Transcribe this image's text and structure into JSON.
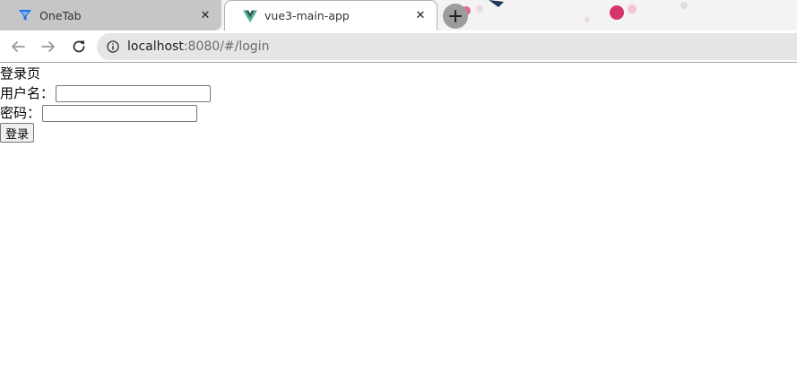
{
  "browser": {
    "tabs": [
      {
        "title": "OneTab",
        "active": false,
        "icon": "onetab-funnel-icon"
      },
      {
        "title": "vue3-main-app",
        "active": true,
        "icon": "vue-logo-icon"
      }
    ],
    "tab_close_glyph": "✕",
    "new_tab_glyph": "+",
    "address": {
      "host": "localhost",
      "path": ":8080/#/login"
    }
  },
  "page": {
    "heading": "登录页",
    "username_label": "用户名：",
    "password_label": "密码：",
    "login_button": "登录"
  },
  "colors": {
    "tab_inactive": "#c6c6c6",
    "omnibox": "#e5e5e5",
    "vue_green": "#41b883",
    "vue_dark": "#35495e",
    "onetab_blue": "#1a73e8"
  }
}
